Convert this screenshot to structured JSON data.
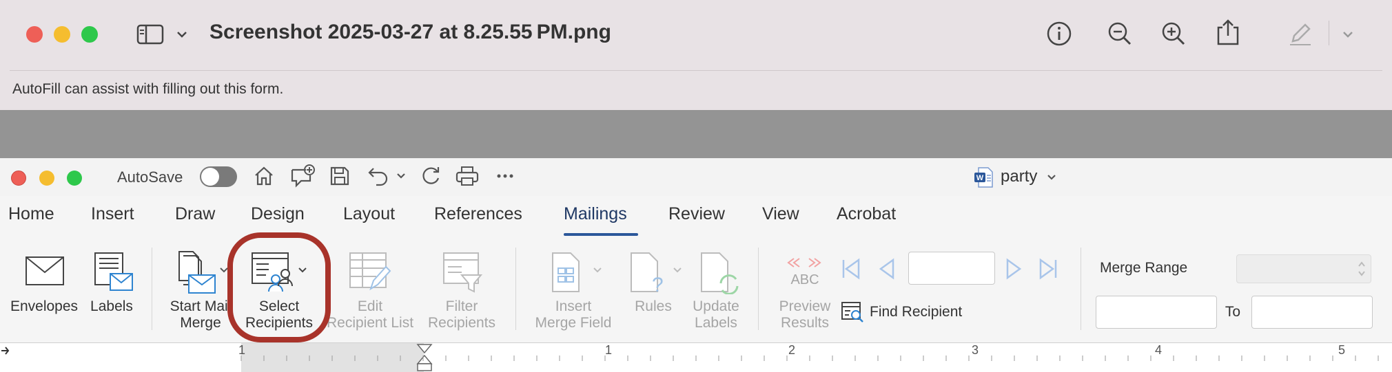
{
  "preview": {
    "title": "Screenshot 2025-03-27 at 8.25.55 PM.png",
    "autofill": "AutoFill can assist with filling out this form."
  },
  "word": {
    "autosave_label": "AutoSave",
    "doc_name": "party",
    "tabs": [
      "Home",
      "Insert",
      "Draw",
      "Design",
      "Layout",
      "References",
      "Mailings",
      "Review",
      "View",
      "Acrobat"
    ],
    "active_tab": "Mailings",
    "ribbon": {
      "envelopes": "Envelopes",
      "labels": "Labels",
      "start_mail_merge": [
        "Start Mail",
        "Merge"
      ],
      "select_recipients": [
        "Select",
        "Recipients"
      ],
      "edit_recipient_list": [
        "Edit",
        "Recipient List"
      ],
      "filter_recipients": [
        "Filter",
        "Recipients"
      ],
      "insert_merge_field": [
        "Insert",
        "Merge Field"
      ],
      "rules": "Rules",
      "update_labels": [
        "Update",
        "Labels"
      ],
      "preview_results": [
        "Preview",
        "Results"
      ],
      "abc_label": "ABC",
      "find_recipient": "Find Recipient",
      "merge_range": "Merge Range",
      "to_label": "To"
    },
    "ruler_numbers": [
      "1",
      "1",
      "2",
      "3",
      "4",
      "5"
    ]
  },
  "colors": {
    "highlight_ring": "#a8332a",
    "active_tab_underline": "#2b579a",
    "traffic_red": "#ee5f57",
    "traffic_yellow": "#f5bd2f",
    "traffic_green": "#2ec84b"
  }
}
